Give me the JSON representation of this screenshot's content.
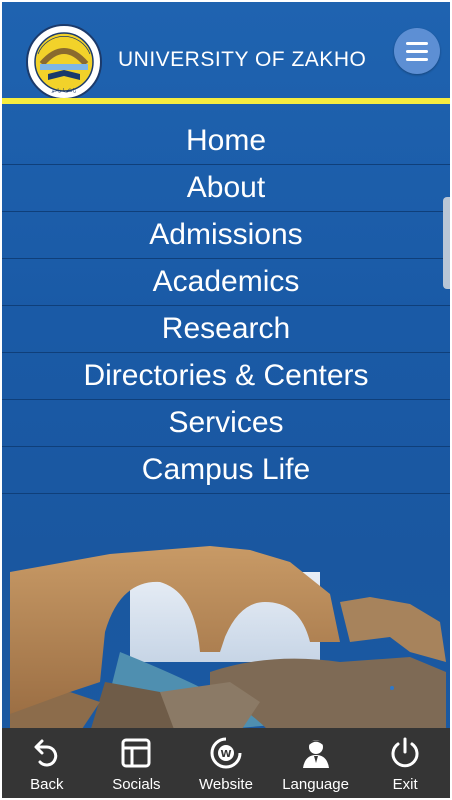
{
  "header": {
    "title": "UNIVERSITY OF ZAKHO",
    "logo_text": "UNIVERSITY OF ZAKHO",
    "menu_icon": "hamburger-menu-icon"
  },
  "nav": {
    "items": [
      {
        "label": "Home"
      },
      {
        "label": "About"
      },
      {
        "label": "Admissions"
      },
      {
        "label": "Academics"
      },
      {
        "label": "Research"
      },
      {
        "label": "Directories & Centers"
      },
      {
        "label": "Services"
      },
      {
        "label": "Campus Life"
      }
    ]
  },
  "bottom_bar": {
    "tabs": [
      {
        "label": "Back",
        "icon": "back-arrow-icon"
      },
      {
        "label": "Socials",
        "icon": "layout-icon"
      },
      {
        "label": "Website",
        "icon": "web-icon"
      },
      {
        "label": "Language",
        "icon": "person-icon"
      },
      {
        "label": "Exit",
        "icon": "power-icon"
      }
    ]
  },
  "colors": {
    "background": "#1a5aa6",
    "accent_rule": "#f6ec3f",
    "bottom_bar": "#353535",
    "menu_button": "#5d8fd4"
  }
}
